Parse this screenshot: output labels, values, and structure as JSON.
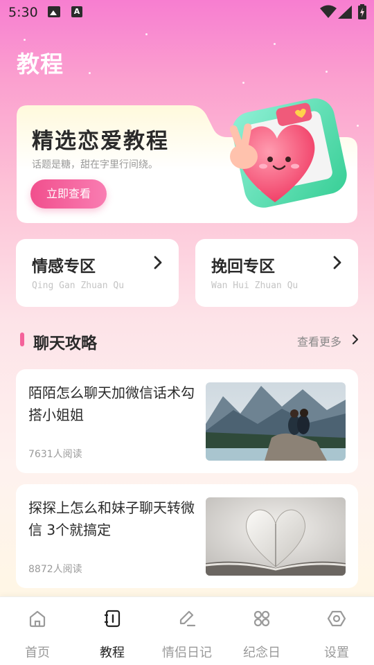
{
  "status_bar": {
    "time": "5:30"
  },
  "header": {
    "title": "教程"
  },
  "banner": {
    "title": "精选恋爱教程",
    "subtitle": "话题是糖，甜在字里行间绕。",
    "button_label": "立即查看"
  },
  "zones": [
    {
      "title": "情感专区",
      "pinyin": "Qing Gan Zhuan Qu"
    },
    {
      "title": "挽回专区",
      "pinyin": "Wan Hui Zhuan Qu"
    }
  ],
  "section": {
    "title": "聊天攻略",
    "more_label": "查看更多"
  },
  "articles": [
    {
      "title": "陌陌怎么聊天加微信话术勾搭小姐姐",
      "reads": "7631人阅读",
      "image": "couple-lake-mountain-photo"
    },
    {
      "title": "探探上怎么和妹子聊天转微信  3个就搞定",
      "reads": "8872人阅读",
      "image": "book-heart-pages-photo"
    }
  ],
  "bottom_nav": {
    "active": 1,
    "items": [
      {
        "label": "首页",
        "icon": "home-icon"
      },
      {
        "label": "教程",
        "icon": "notebook-icon"
      },
      {
        "label": "情侣日记",
        "icon": "edit-icon"
      },
      {
        "label": "纪念日",
        "icon": "grid-icon"
      },
      {
        "label": "设置",
        "icon": "hexagon-settings-icon"
      }
    ]
  },
  "colors": {
    "accent": "#f4629a",
    "banner_button": "#f14f8d"
  }
}
